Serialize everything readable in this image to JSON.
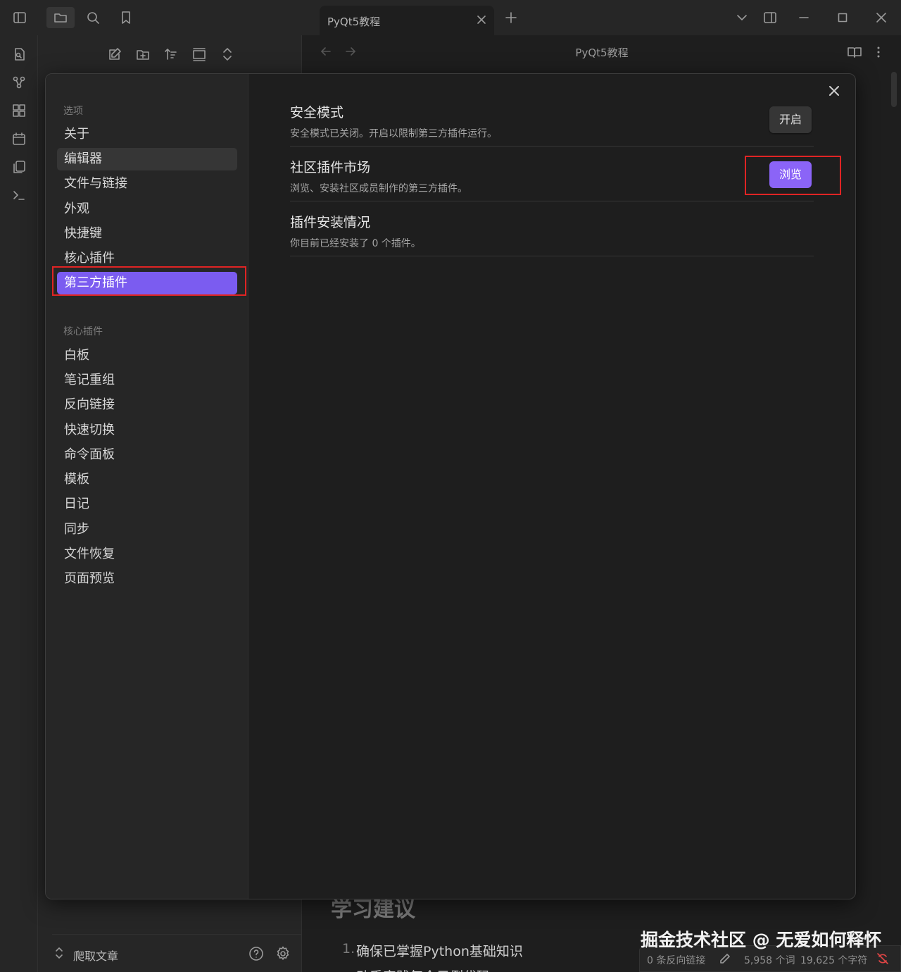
{
  "window": {
    "tab_title": "PyQt5教程",
    "editor_title": "PyQt5教程"
  },
  "file_pane": {
    "vault_name": "爬取文章"
  },
  "document": {
    "heading": "学习建议",
    "list_number": "1.",
    "list_item": "确保已掌握Python基础知识",
    "list_item_2": "动手实践每个示例代码"
  },
  "watermark": "掘金技术社区 @ 无爱如何释怀",
  "status_bar": {
    "backlinks": "0 条反向链接",
    "words": "5,958 个词",
    "chars": "19,625 个字符"
  },
  "settings": {
    "sidebar": {
      "options_header": "选项",
      "options": [
        {
          "label": "关于"
        },
        {
          "label": "编辑器"
        },
        {
          "label": "文件与链接"
        },
        {
          "label": "外观"
        },
        {
          "label": "快捷键"
        },
        {
          "label": "核心插件"
        },
        {
          "label": "第三方插件"
        }
      ],
      "core_header": "核心插件",
      "core_plugins": [
        {
          "label": "白板"
        },
        {
          "label": "笔记重组"
        },
        {
          "label": "反向链接"
        },
        {
          "label": "快速切换"
        },
        {
          "label": "命令面板"
        },
        {
          "label": "模板"
        },
        {
          "label": "日记"
        },
        {
          "label": "同步"
        },
        {
          "label": "文件恢复"
        },
        {
          "label": "页面预览"
        }
      ]
    },
    "items": [
      {
        "name": "安全模式",
        "desc": "安全模式已关闭。开启以限制第三方插件运行。",
        "button": "开启"
      },
      {
        "name": "社区插件市场",
        "desc": "浏览、安装社区成员制作的第三方插件。",
        "button": "浏览"
      },
      {
        "name": "插件安装情况",
        "desc": "你目前已经安装了 0 个插件。"
      }
    ]
  },
  "colors": {
    "accent": "#8b64f7",
    "highlight_box": "#e02424",
    "background": "#1e1e1e"
  }
}
